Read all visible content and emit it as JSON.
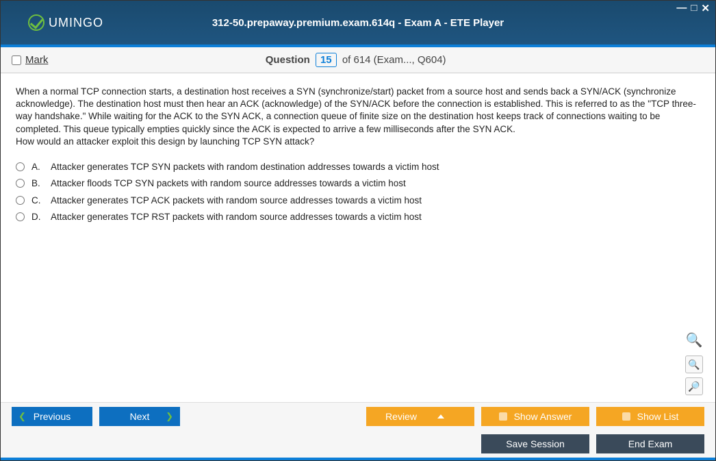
{
  "window": {
    "title": "312-50.prepaway.premium.exam.614q - Exam A - ETE Player",
    "logo_text": "UMINGO"
  },
  "header": {
    "mark_label": "Mark",
    "question_label": "Question",
    "question_number": "15",
    "of_text": "of 614 (Exam..., Q604)"
  },
  "question": {
    "text_p1": "When a normal TCP connection starts, a destination host receives a SYN (synchronize/start) packet from a source host and sends back a SYN/ACK (synchronize acknowledge). The destination host must then hear an ACK (acknowledge) of the SYN/ACK before the connection is established. This is referred to as the \"TCP three-way handshake.\" While waiting for the ACK to the SYN ACK, a connection queue of finite size on the destination host keeps track of connections waiting to be completed. This queue typically empties quickly since the ACK is expected to arrive a few milliseconds after the SYN ACK.",
    "text_p2": "How would an attacker exploit this design by launching TCP SYN attack?",
    "options": [
      {
        "letter": "A.",
        "text": "Attacker generates TCP SYN packets with random destination addresses towards a victim host"
      },
      {
        "letter": "B.",
        "text": "Attacker floods TCP SYN packets with random source addresses towards a victim host"
      },
      {
        "letter": "C.",
        "text": "Attacker generates TCP ACK packets with random source addresses towards a victim host"
      },
      {
        "letter": "D.",
        "text": "Attacker generates TCP RST packets with random source addresses towards a victim host"
      }
    ]
  },
  "footer": {
    "previous": "Previous",
    "next": "Next",
    "review": "Review",
    "show_answer": "Show Answer",
    "show_list": "Show List",
    "save_session": "Save Session",
    "end_exam": "End Exam"
  }
}
